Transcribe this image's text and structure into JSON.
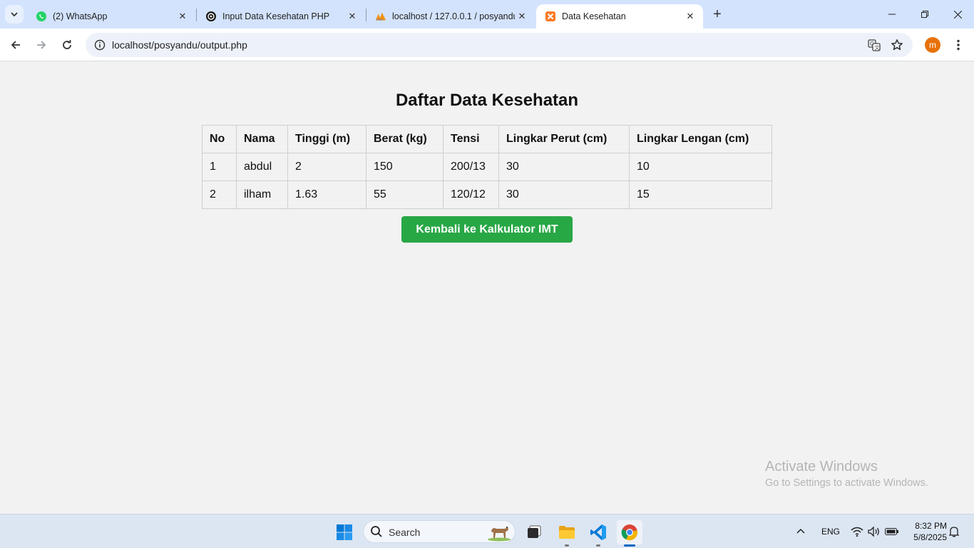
{
  "browser": {
    "tabs": [
      {
        "label": "(2) WhatsApp",
        "icon": "whatsapp-icon"
      },
      {
        "label": "Input Data Kesehatan PHP",
        "icon": "chatgpt-icon"
      },
      {
        "label": "localhost / 127.0.0.1 / posyandu",
        "icon": "phpmyadmin-icon"
      },
      {
        "label": "Data Kesehatan",
        "icon": "xampp-icon",
        "active": true
      }
    ],
    "url": "localhost/posyandu/output.php",
    "profile_initial": "m"
  },
  "page": {
    "title": "Daftar Data Kesehatan",
    "table": {
      "headers": [
        "No",
        "Nama",
        "Tinggi (m)",
        "Berat (kg)",
        "Tensi",
        "Lingkar Perut (cm)",
        "Lingkar Lengan (cm)"
      ],
      "rows": [
        [
          "1",
          "abdul",
          "2",
          "150",
          "200/13",
          "30",
          "10"
        ],
        [
          "2",
          "ilham",
          "1.63",
          "55",
          "120/12",
          "30",
          "15"
        ]
      ]
    },
    "back_button": "Kembali ke Kalkulator IMT",
    "watermark": {
      "line1": "Activate Windows",
      "line2": "Go to Settings to activate Windows."
    }
  },
  "taskbar": {
    "search_label": "Search",
    "language": "ENG",
    "time": "8:32 PM",
    "date": "5/8/2025"
  },
  "colors": {
    "accent_button": "#28a745",
    "tabstrip": "#d3e3fd",
    "page_bg": "#f2f2f2"
  }
}
